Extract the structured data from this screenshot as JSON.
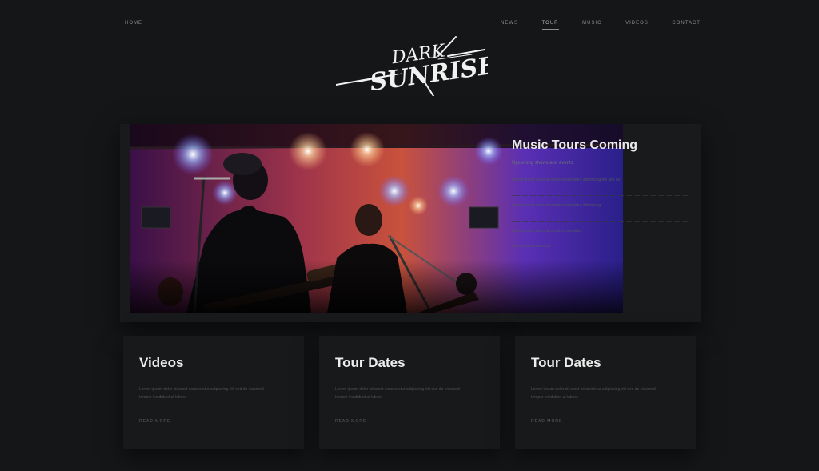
{
  "nav": {
    "home": "HOME",
    "items": [
      {
        "label": "NEWS",
        "active": false
      },
      {
        "label": "TOUR",
        "active": true
      },
      {
        "label": "MUSIC",
        "active": false
      },
      {
        "label": "VIDEOS",
        "active": false
      },
      {
        "label": "CONTACT",
        "active": false
      }
    ]
  },
  "logo": {
    "text": "DARK SUNRISE"
  },
  "hero": {
    "title": "Music Tours Coming",
    "subtitle": "Upcoming shows and events",
    "lines": [
      "Lorem ipsum dolor sit amet consectetur adipiscing elit sed do",
      "Lorem ipsum dolor sit amet consectetur adipiscing",
      "Lorem ipsum dolor sit amet consectetur",
      "Lorem ipsum dolor sit"
    ]
  },
  "cards": [
    {
      "title": "Videos",
      "body": "Lorem ipsum dolor sit amet consectetur adipiscing elit sed do eiusmod tempor incididunt ut labore",
      "more": "READ MORE"
    },
    {
      "title": "Tour Dates",
      "body": "Lorem ipsum dolor sit amet consectetur adipiscing elit sed do eiusmod tempor incididunt ut labore",
      "more": "READ MORE"
    },
    {
      "title": "Tour Dates",
      "body": "Lorem ipsum dolor sit amet consectetur adipiscing elit sed do eiusmod tempor incididunt ut labore",
      "more": "READ MORE"
    }
  ],
  "colors": {
    "background": "#141617",
    "card": "#17191b",
    "accent": "#e9eaeb"
  }
}
